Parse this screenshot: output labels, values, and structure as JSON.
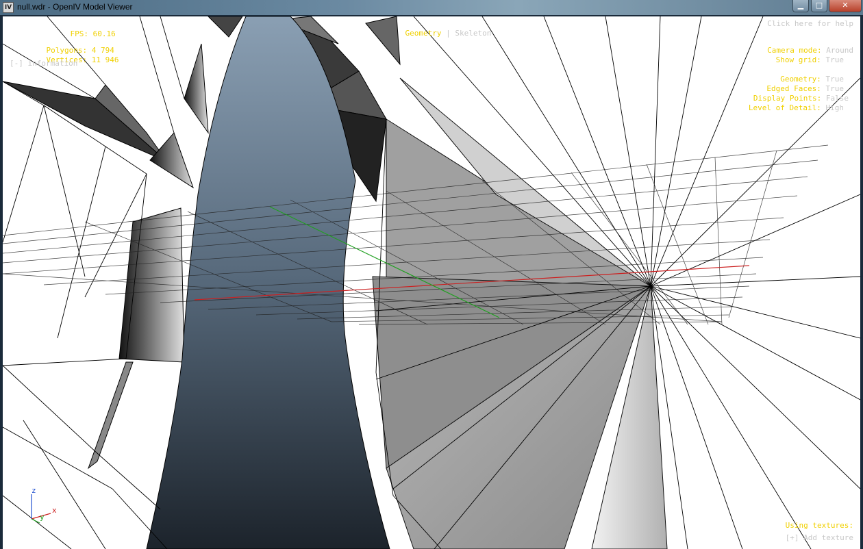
{
  "window": {
    "icon_label": "IV",
    "title": "null.wdr - OpenIV Model Viewer",
    "buttons": {
      "minimize": "▁",
      "maximize": "□",
      "close": "✕"
    }
  },
  "hud_left": {
    "fps_label": "FPS:",
    "fps_value": "60.16",
    "polygons_label": "Polygons:",
    "polygons_value": "4 794",
    "vertices_label": "Vertices:",
    "vertices_value": "11 946",
    "info_toggle": "[-] information"
  },
  "hud_top": {
    "geometry_tab": "Geometry",
    "separator": "|",
    "skeleton_tab": "Skeleton"
  },
  "hud_right": {
    "help_link": "Click here for help",
    "camera_mode_label": "Camera mode:",
    "camera_mode_value": "Around",
    "show_grid_label": "Show grid:",
    "show_grid_value": "True",
    "geometry_label": "Geometry:",
    "geometry_value": "True",
    "edged_faces_label": "Edged Faces:",
    "edged_faces_value": "True",
    "display_points_label": "Display Points:",
    "display_points_value": "False",
    "lod_label": "Level of Detail:",
    "lod_value": "High"
  },
  "hud_bottom_right": {
    "using_textures_label": "Using textures:",
    "add_texture": "[+] Add texture"
  },
  "axis": {
    "z": "z",
    "y": "y",
    "x": "x"
  },
  "colors": {
    "hud_yellow": "#f0d000",
    "hud_gray": "#c8c8c8",
    "x_axis": "#cc2020",
    "y_axis": "#20a020",
    "z_axis": "#2050d0"
  }
}
